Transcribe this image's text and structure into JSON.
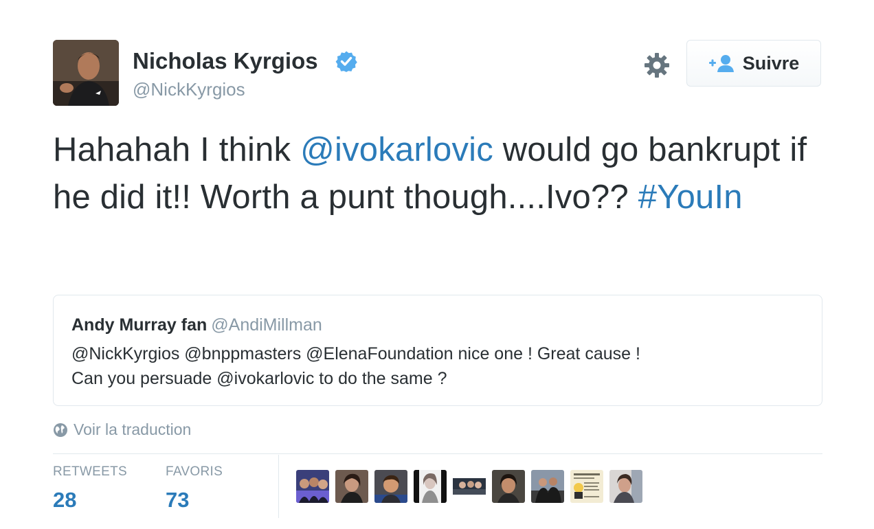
{
  "author": {
    "name": "Nicholas Kyrgios",
    "handle": "@NickKyrgios",
    "verified": true,
    "avatar_icon": "profile-photo"
  },
  "actions": {
    "settings_icon": "gear-icon",
    "follow_label": "Suivre",
    "follow_icon": "add-user-icon"
  },
  "tweet": {
    "segments": [
      {
        "text": "Hahahah I think ",
        "type": "text"
      },
      {
        "text": "@ivokarlovic",
        "type": "mention"
      },
      {
        "text": " would go bankrupt if he did it!! Worth a punt though....Ivo?? ",
        "type": "text"
      },
      {
        "text": "#YouIn",
        "type": "hashtag"
      }
    ]
  },
  "quote": {
    "name": "Andy Murray fan",
    "handle": "@AndiMillman",
    "line1": "@NickKyrgios @bnppmasters @ElenaFoundation nice one ! Great cause !",
    "line2": "Can you persuade @ivokarlovic to do the same ?"
  },
  "translation": {
    "label": "Voir la traduction",
    "icon": "globe-icon"
  },
  "stats": {
    "retweets_label": "RETWEETS",
    "retweets_value": "28",
    "favorites_label": "FAVORIS",
    "favorites_value": "73"
  },
  "colors": {
    "link": "#2b7bb9",
    "text": "#292f33",
    "muted": "#8899a6",
    "border": "#e1e8ed",
    "verified": "#55acee"
  },
  "favorited_by": [
    {
      "icon": "user-avatar-1"
    },
    {
      "icon": "user-avatar-2"
    },
    {
      "icon": "user-avatar-3"
    },
    {
      "icon": "user-avatar-4"
    },
    {
      "icon": "user-avatar-5"
    },
    {
      "icon": "user-avatar-6"
    },
    {
      "icon": "user-avatar-7"
    },
    {
      "icon": "user-avatar-8"
    },
    {
      "icon": "user-avatar-9"
    }
  ]
}
